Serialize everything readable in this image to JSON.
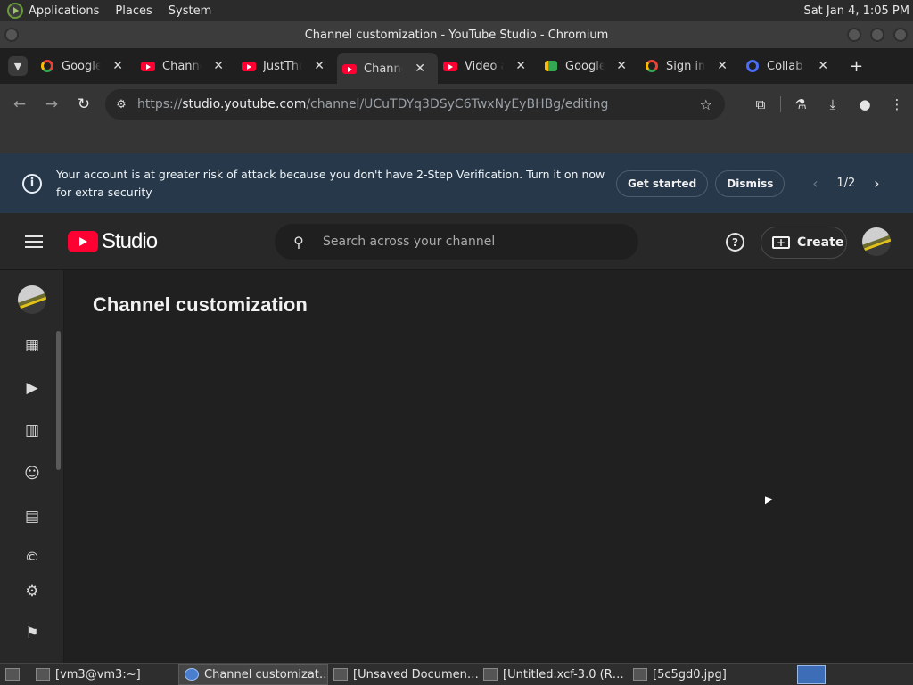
{
  "system_bar": {
    "menus": [
      "Applications",
      "Places",
      "System"
    ],
    "clock": "Sat Jan  4,  1:05 PM"
  },
  "window": {
    "title": "Channel customization - YouTube Studio - Chromium"
  },
  "tabs": [
    {
      "title": "Google",
      "icon": "google-icon"
    },
    {
      "title": "Channel",
      "icon": "youtube-icon"
    },
    {
      "title": "JustThe",
      "icon": "youtube-icon"
    },
    {
      "title": "Channel",
      "icon": "youtube-icon",
      "active": true
    },
    {
      "title": "Video a",
      "icon": "youtube-icon"
    },
    {
      "title": "Google",
      "icon": "google-meet-icon"
    },
    {
      "title": "Sign in",
      "icon": "google-icon"
    },
    {
      "title": "Collab",
      "icon": "collab-icon"
    }
  ],
  "address_bar": {
    "scheme": "https://",
    "host": "studio.youtube.com",
    "path": "/channel/UCuTDYq3DSyC6TwxNyEyBHBg/editing"
  },
  "banner": {
    "message": "Your account is at greater risk of attack because you don't have 2-Step Verification. Turn it on now for extra security",
    "get_started": "Get started",
    "dismiss": "Dismiss",
    "pager": "1/2"
  },
  "studio": {
    "logo_word": "Studio",
    "search_placeholder": "Search across your channel",
    "create_label": "Create",
    "page_title": "Channel customization"
  },
  "sidebar_icons": [
    "dashboard-icon",
    "content-icon",
    "analytics-icon",
    "community-icon",
    "subtitles-icon",
    "copyright-icon",
    "settings-icon",
    "feedback-icon"
  ],
  "taskbar": {
    "items": [
      "[vm3@vm3:~]",
      "Channel customizat…",
      "[Unsaved Documen…",
      "[Untitled.xcf-3.0 (R…",
      "[5c5gd0.jpg]"
    ]
  },
  "colors": {
    "youtube_red": "#ff0033",
    "banner_bg": "#263849",
    "studio_bg": "#282828"
  }
}
